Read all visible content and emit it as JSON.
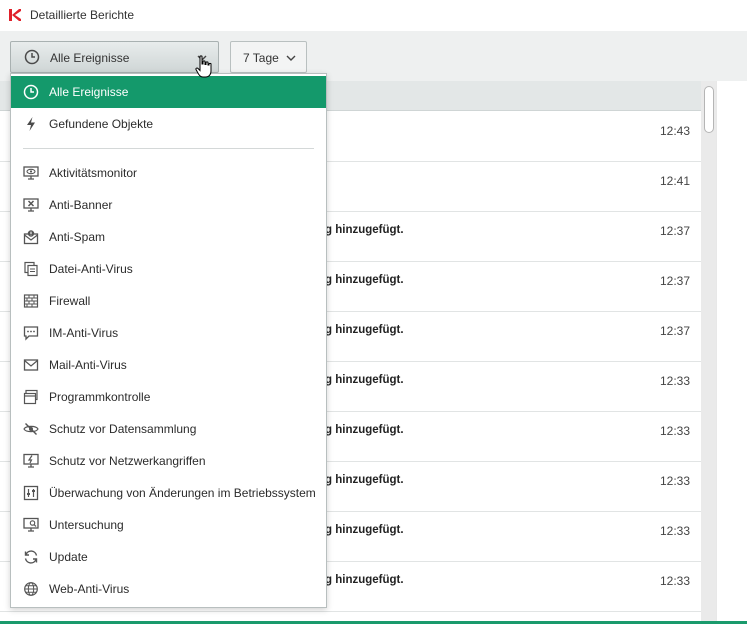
{
  "window": {
    "title": "Detaillierte Berichte",
    "logo_icon": "kaspersky-k-logo",
    "accent_color": "#14996b"
  },
  "toolbar": {
    "filter_selected": "Alle Ereignisse",
    "period_selected": "7 Tage"
  },
  "dropdown": {
    "top_items": [
      {
        "label": "Alle Ereignisse",
        "icon": "clock-icon",
        "selected": true
      },
      {
        "label": "Gefundene Objekte",
        "icon": "lightning-icon",
        "selected": false
      }
    ],
    "items": [
      {
        "label": "Aktivitätsmonitor",
        "icon": "monitor-eye-icon"
      },
      {
        "label": "Anti-Banner",
        "icon": "banner-block-icon"
      },
      {
        "label": "Anti-Spam",
        "icon": "spam-envelope-icon"
      },
      {
        "label": "Datei-Anti-Virus",
        "icon": "files-icon"
      },
      {
        "label": "Firewall",
        "icon": "firewall-brick-icon"
      },
      {
        "label": "IM-Anti-Virus",
        "icon": "chat-bubble-icon"
      },
      {
        "label": "Mail-Anti-Virus",
        "icon": "mail-icon"
      },
      {
        "label": "Programmkontrolle",
        "icon": "app-window-icon"
      },
      {
        "label": "Schutz vor Datensammlung",
        "icon": "eye-off-icon"
      },
      {
        "label": "Schutz vor Netzwerkangriffen",
        "icon": "network-shield-icon"
      },
      {
        "label": "Überwachung von Änderungen im Betriebssystem",
        "icon": "sliders-icon"
      },
      {
        "label": "Untersuchung",
        "icon": "scan-monitor-icon"
      },
      {
        "label": "Update",
        "icon": "refresh-icon"
      },
      {
        "label": "Web-Anti-Virus",
        "icon": "globe-icon"
      }
    ]
  },
  "events": [
    {
      "text": "",
      "time": "12:43"
    },
    {
      "text": "",
      "time": "12:41"
    },
    {
      "text": "g hinzugefügt.",
      "time": "12:37"
    },
    {
      "text": "g hinzugefügt.",
      "time": "12:37"
    },
    {
      "text": "g hinzugefügt.",
      "time": "12:37"
    },
    {
      "text": "g hinzugefügt.",
      "time": "12:33"
    },
    {
      "text": "g hinzugefügt.",
      "time": "12:33"
    },
    {
      "text": "g hinzugefügt.",
      "time": "12:33"
    },
    {
      "text": "g hinzugefügt.",
      "time": "12:33"
    },
    {
      "text": "g hinzugefügt.",
      "time": "12:33"
    }
  ]
}
